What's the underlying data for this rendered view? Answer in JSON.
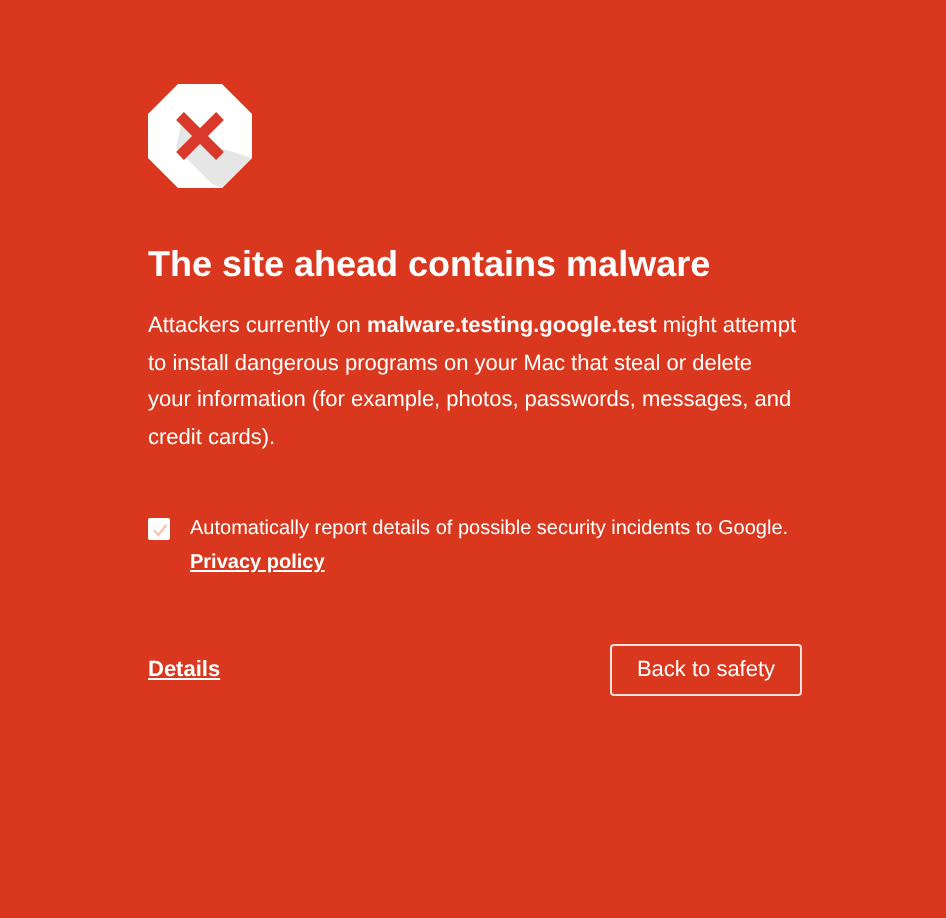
{
  "heading": "The site ahead contains malware",
  "message": "Attackers currently on **malware.testing.google.test** might attempt to install dangerous programs on your Mac that steal or delete your information (for example, photos, passwords, messages, and credit cards).",
  "report_option": {
    "label": "Automatically report details of possible security incidents to Google.",
    "checked": true,
    "link": "Privacy policy"
  },
  "details_link": "Details",
  "primary_button": "Back to safety"
}
